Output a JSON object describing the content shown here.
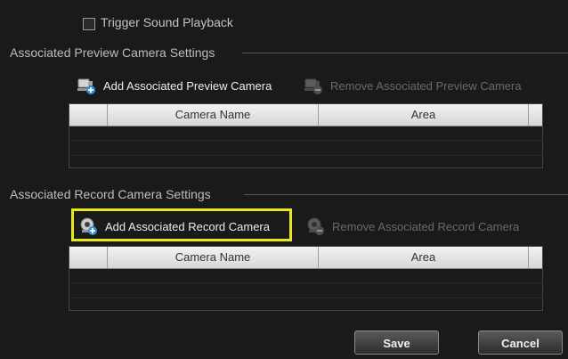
{
  "trigger_sound": {
    "label": "Trigger Sound Playback",
    "checked": false
  },
  "preview_section": {
    "title": "Associated Preview Camera Settings",
    "add_label": "Add Associated Preview Camera",
    "remove_label": "Remove Associated Preview Camera",
    "columns": [
      "Camera Name",
      "Area"
    ]
  },
  "record_section": {
    "title": "Associated Record  Camera Settings",
    "add_label": "Add Associated Record  Camera",
    "remove_label": "Remove Associated Record  Camera",
    "columns": [
      "Camera Name",
      "Area"
    ]
  },
  "buttons": {
    "save": "Save",
    "cancel": "Cancel"
  },
  "colors": {
    "highlight": "#e8e81c",
    "background": "#1a1a1a"
  },
  "icons": {
    "add_preview": "add-camera-icon",
    "remove_preview": "remove-camera-icon",
    "add_record": "add-record-camera-icon",
    "remove_record": "remove-record-camera-icon"
  }
}
